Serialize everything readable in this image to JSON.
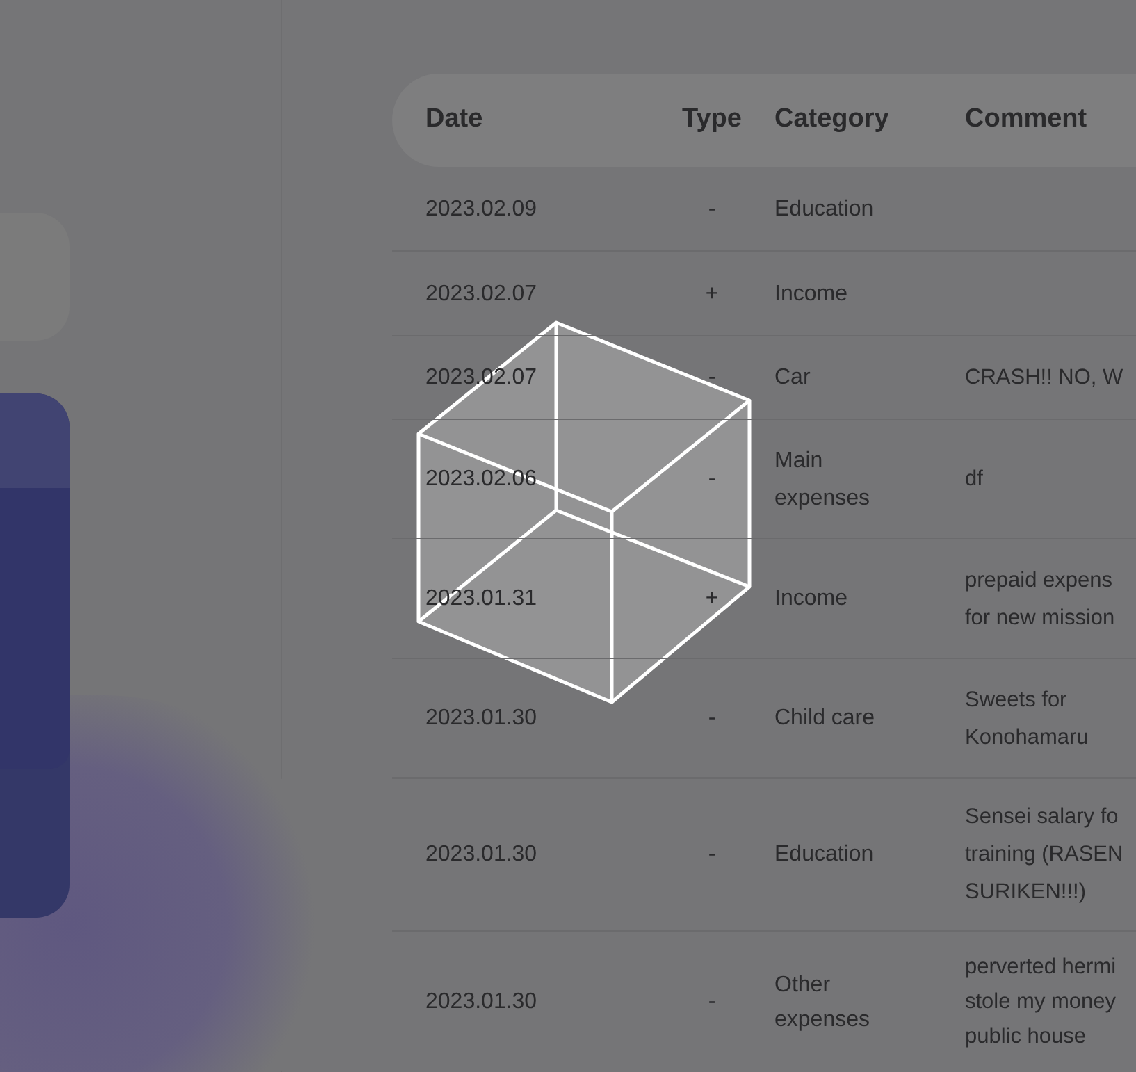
{
  "table": {
    "columns": [
      "Date",
      "Type",
      "Category",
      "Comment"
    ],
    "rows": [
      {
        "date": "2023.02.09",
        "type": "-",
        "category": [
          "Education"
        ],
        "comment": []
      },
      {
        "date": "2023.02.07",
        "type": "+",
        "category": [
          "Income"
        ],
        "comment": []
      },
      {
        "date": "2023.02.07",
        "type": "-",
        "category": [
          "Car"
        ],
        "comment": [
          "CRASH!! NO, W"
        ]
      },
      {
        "date": "2023.02.06",
        "type": "-",
        "category": [
          "Main",
          "expenses"
        ],
        "comment": [
          "df"
        ]
      },
      {
        "date": "2023.01.31",
        "type": "+",
        "category": [
          "Income"
        ],
        "comment": [
          "prepaid expens",
          "for new mission"
        ]
      },
      {
        "date": "2023.01.30",
        "type": "-",
        "category": [
          "Child care"
        ],
        "comment": [
          "Sweets for",
          "Konohamaru"
        ]
      },
      {
        "date": "2023.01.30",
        "type": "-",
        "category": [
          "Education"
        ],
        "comment": [
          "Sensei salary fo",
          "training (RASEN",
          "SURIKEN!!!)"
        ]
      },
      {
        "date": "2023.01.30",
        "type": "-",
        "category": [
          "Other",
          "expenses"
        ],
        "comment": [
          "perverted hermi",
          "stole my money",
          "public house"
        ]
      }
    ]
  }
}
